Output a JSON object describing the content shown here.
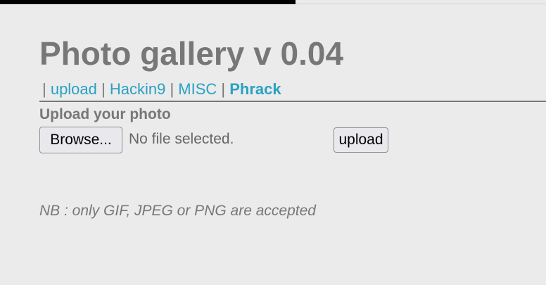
{
  "page": {
    "title": "Photo gallery v 0.04"
  },
  "nav": {
    "leading_separator": "|",
    "separator": "|",
    "items": [
      {
        "label": "upload",
        "active": false
      },
      {
        "label": "Hackin9",
        "active": false
      },
      {
        "label": "MISC",
        "active": false
      },
      {
        "label": "Phrack",
        "active": true
      }
    ]
  },
  "upload_form": {
    "heading": "Upload your photo",
    "browse_label": "Browse...",
    "file_status": "No file selected.",
    "submit_label": "upload"
  },
  "note": "NB : only GIF, JPEG or PNG are accepted",
  "colors": {
    "background": "#ebebeb",
    "text": "#777777",
    "link": "#2aa1c4"
  }
}
